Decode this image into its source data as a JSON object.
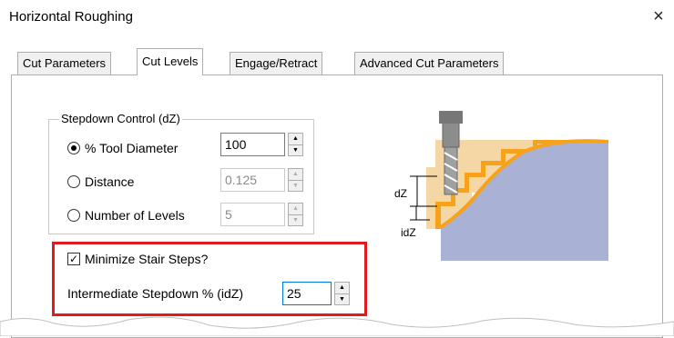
{
  "window": {
    "title": "Horizontal Roughing",
    "close_glyph": "×"
  },
  "tabs": [
    {
      "label": "Cut Parameters"
    },
    {
      "label": "Cut Levels",
      "active": true
    },
    {
      "label": "Engage/Retract"
    },
    {
      "label": "Advanced Cut Parameters"
    }
  ],
  "stepdown": {
    "group_label": "Stepdown Control (dZ)",
    "options": [
      {
        "label": "% Tool Diameter",
        "value": "100",
        "selected": true,
        "enabled": true
      },
      {
        "label": "Distance",
        "value": "0.125",
        "selected": false,
        "enabled": false
      },
      {
        "label": "Number of Levels",
        "value": "5",
        "selected": false,
        "enabled": false
      }
    ]
  },
  "stair_steps": {
    "checkbox_label": "Minimize Stair Steps?",
    "checked": true,
    "intermediate_label": "Intermediate Stepdown % (idZ)",
    "intermediate_value": "25"
  },
  "illustration": {
    "dz_label": "dZ",
    "idz_label": "idZ"
  },
  "colors": {
    "highlight": "#e01b1b",
    "material_orange": "#f7a21b",
    "material_tan": "#f5d7a5",
    "part_blue": "#a9b1d4",
    "tool_gray": "#8c8c8c"
  }
}
